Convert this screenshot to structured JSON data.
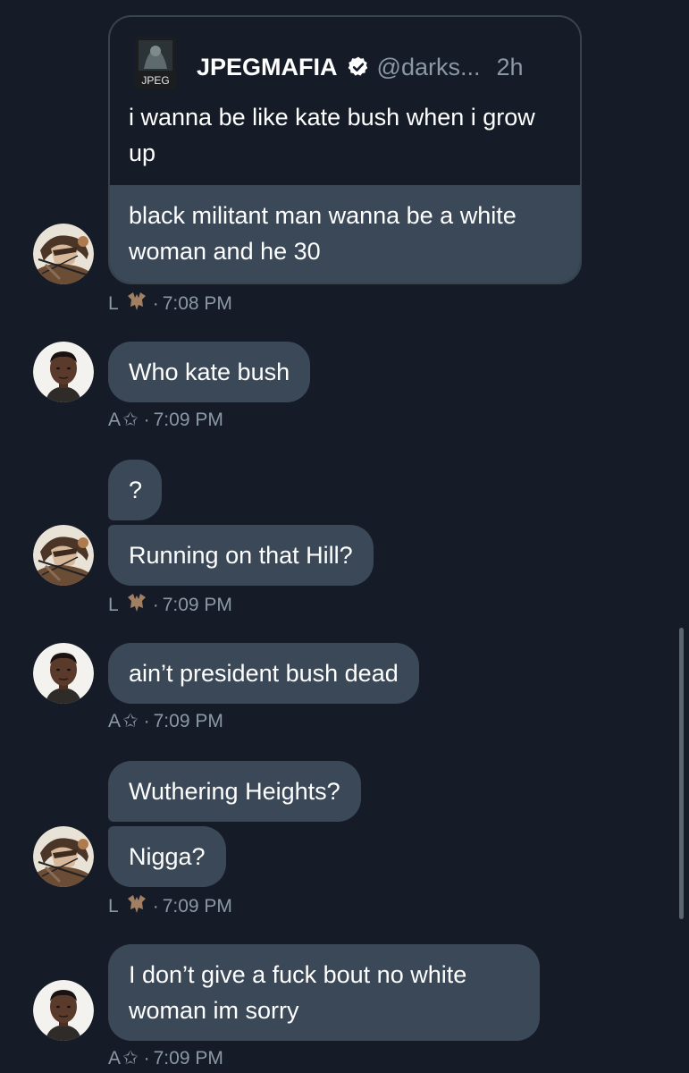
{
  "quoted_tweet": {
    "logo_text": "JPEG",
    "author_name": "JPEGMAFIA",
    "handle": "@darks...",
    "age": "2h",
    "text": "i wanna be like kate bush when i grow up"
  },
  "messages": [
    {
      "sender": "L",
      "text": "black militant man wanna be a white woman and he 30"
    },
    {
      "sender": "A",
      "text": "Who kate bush"
    },
    {
      "sender": "L",
      "text": "?"
    },
    {
      "sender": "L",
      "text": "Running on that Hill?"
    },
    {
      "sender": "A",
      "text": "ain’t president bush dead"
    },
    {
      "sender": "L",
      "text": "Wuthering Heights?"
    },
    {
      "sender": "L",
      "text": "Nigga?"
    },
    {
      "sender": "A",
      "text": "I don’t give a fuck bout no white woman im sorry"
    }
  ],
  "meta": [
    {
      "initial": "L",
      "glyph": "🦇",
      "time": "7:08 PM"
    },
    {
      "initial": "A",
      "glyph": "✩",
      "time": "7:09 PM"
    },
    {
      "initial": "L",
      "glyph": "🦇",
      "time": "7:09 PM"
    },
    {
      "initial": "A",
      "glyph": "✩",
      "time": "7:09 PM"
    },
    {
      "initial": "L",
      "glyph": "🦇",
      "time": "7:09 PM"
    },
    {
      "initial": "A",
      "glyph": "✩",
      "time": "7:09 PM"
    }
  ],
  "time_separator": "·",
  "colors": {
    "background": "#151c27",
    "bubble": "#3a4858",
    "card_border": "#38444d",
    "secondary_text": "#8b98a5",
    "verified_badge": "#ffffff"
  },
  "icons": {
    "verified": "verified-badge-icon",
    "avatar_l": "anime-character-avatar",
    "avatar_a": "person-photo-avatar",
    "logo": "jpeg-logo"
  }
}
